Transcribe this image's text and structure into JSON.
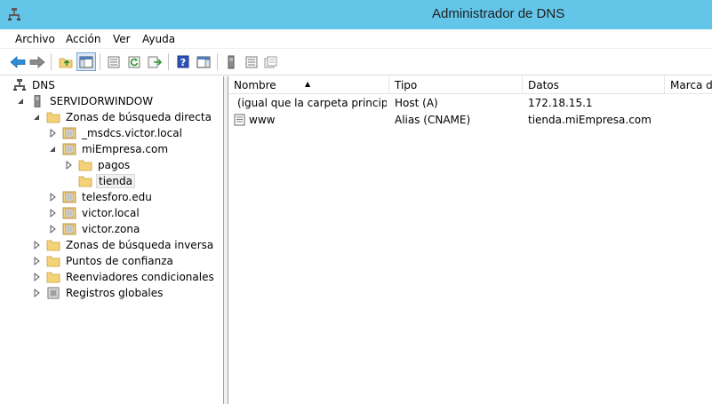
{
  "window": {
    "title": "Administrador de DNS"
  },
  "menu": [
    "Archivo",
    "Acción",
    "Ver",
    "Ayuda"
  ],
  "toolbar": {
    "buttons": [
      "back-icon",
      "forward-icon",
      "up-folder-icon",
      "show-hide-tree-icon",
      "export-list-icon",
      "refresh-icon",
      "export-icon",
      "help-icon",
      "show-action-pane-icon",
      "server-icon",
      "record-list-icon",
      "properties-icon"
    ]
  },
  "tree": {
    "root": "DNS",
    "server": "SERVIDORWINDOW",
    "forward_zones": "Zonas de búsqueda directa",
    "zones": {
      "msdcs": "_msdcs.victor.local",
      "miempresa": "miEmpresa.com",
      "pagos": "pagos",
      "tienda": "tienda",
      "telesforo": "telesforo.edu",
      "victor_local": "victor.local",
      "victor_zona": "victor.zona"
    },
    "reverse_zones": "Zonas de búsqueda inversa",
    "trust_points": "Puntos de confianza",
    "conditional_forwarders": "Reenviadores condicionales",
    "global_logs": "Registros globales"
  },
  "list": {
    "columns": [
      "Nombre",
      "Tipo",
      "Datos",
      "Marca de"
    ],
    "rows": [
      {
        "name": "(igual que la carpeta princip...",
        "type": "Host (A)",
        "data": "172.18.15.1"
      },
      {
        "name": "www",
        "type": "Alias (CNAME)",
        "data": "tienda.miEmpresa.com"
      }
    ]
  },
  "colors": {
    "titlebar": "#63c6e8",
    "folder": "#f5d27a",
    "selection": "#f0f0f0"
  }
}
